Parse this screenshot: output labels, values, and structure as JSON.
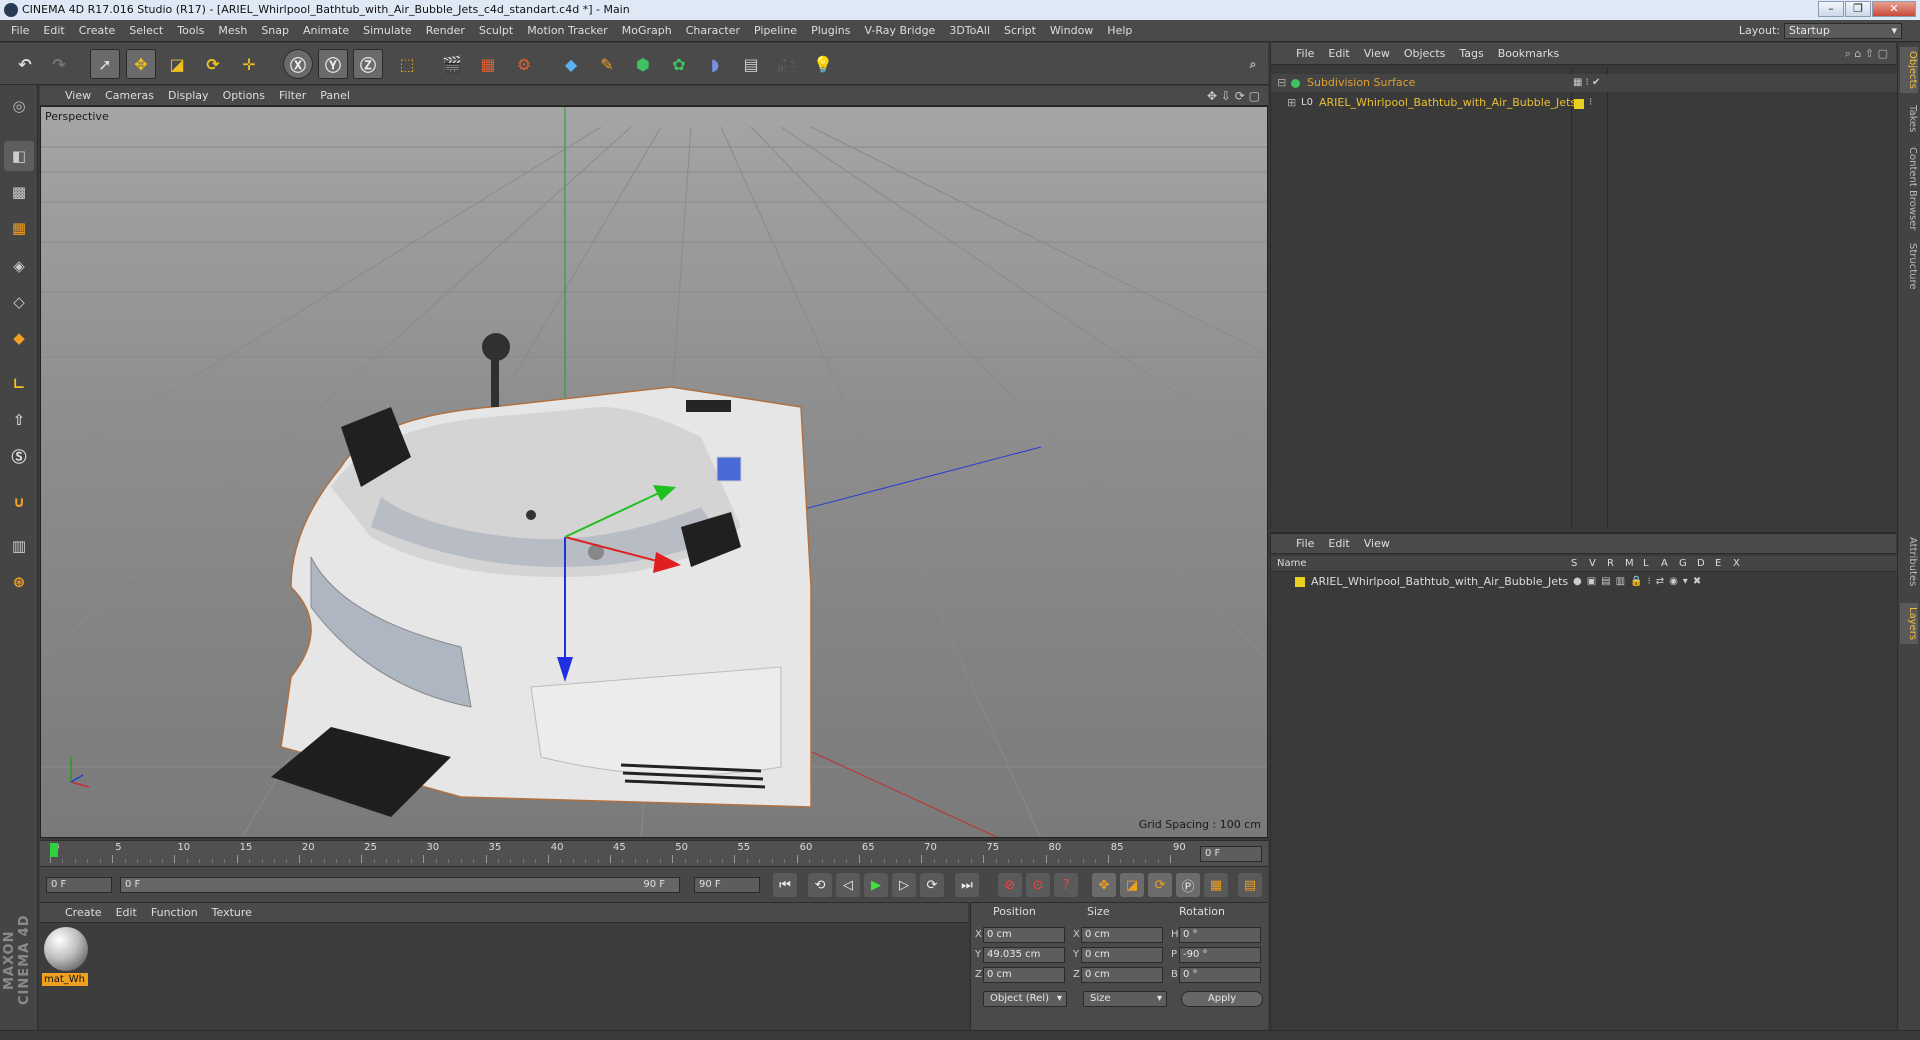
{
  "window": {
    "title": "CINEMA 4D R17.016 Studio (R17) - [ARIEL_Whirlpool_Bathtub_with_Air_Bubble_Jets_c4d_standart.c4d *] - Main"
  },
  "menubar": {
    "items": [
      "File",
      "Edit",
      "Create",
      "Select",
      "Tools",
      "Mesh",
      "Snap",
      "Animate",
      "Simulate",
      "Render",
      "Sculpt",
      "Motion Tracker",
      "MoGraph",
      "Character",
      "Pipeline",
      "Plugins",
      "V-Ray Bridge",
      "3DToAll",
      "Script",
      "Window",
      "Help"
    ],
    "layout_label": "Layout:",
    "layout_value": "Startup"
  },
  "viewport": {
    "menu": [
      "View",
      "Cameras",
      "Display",
      "Options",
      "Filter",
      "Panel"
    ],
    "label": "Perspective",
    "grid_spacing": "Grid Spacing : 100 cm"
  },
  "timeline": {
    "ticks": [
      "0",
      "5",
      "10",
      "15",
      "20",
      "25",
      "30",
      "35",
      "40",
      "45",
      "50",
      "55",
      "60",
      "65",
      "70",
      "75",
      "80",
      "85",
      "90"
    ],
    "end_field": "0 F"
  },
  "anim": {
    "start": "0 F",
    "range_start": "0 F",
    "range_end": "90 F",
    "end": "90 F"
  },
  "material_panel": {
    "menu": [
      "Create",
      "Edit",
      "Function",
      "Texture"
    ],
    "material_name": "mat_Wh"
  },
  "coords": {
    "headers": {
      "position": "Position",
      "size": "Size",
      "rotation": "Rotation"
    },
    "rows": [
      {
        "axis": "X",
        "pos": "0 cm",
        "size_axis": "X",
        "size": "0 cm",
        "rot_axis": "H",
        "rot": "0 °"
      },
      {
        "axis": "Y",
        "pos": "49.035 cm",
        "size_axis": "Y",
        "size": "0 cm",
        "rot_axis": "P",
        "rot": "-90 °"
      },
      {
        "axis": "Z",
        "pos": "0 cm",
        "size_axis": "Z",
        "size": "0 cm",
        "rot_axis": "B",
        "rot": "0 °"
      }
    ],
    "mode": "Object (Rel)",
    "size_mode": "Size",
    "apply": "Apply"
  },
  "objects_panel": {
    "menu": [
      "File",
      "Edit",
      "View",
      "Objects",
      "Tags",
      "Bookmarks"
    ],
    "items": [
      {
        "name": "Subdivision Surface",
        "color": "#e0a030"
      },
      {
        "name": "ARIEL_Whirlpool_Bathtub_with_Air_Bubble_Jets",
        "color": "#e8c030"
      }
    ]
  },
  "layers_panel": {
    "menu": [
      "File",
      "Edit",
      "View"
    ],
    "columns": [
      "Name",
      "S",
      "V",
      "R",
      "M",
      "L",
      "A",
      "G",
      "D",
      "E",
      "X"
    ],
    "rows": [
      {
        "name": "ARIEL_Whirlpool_Bathtub_with_Air_Bubble_Jets",
        "color": "#e8d020"
      }
    ]
  },
  "side_tabs": [
    "Objects",
    "Takes",
    "Content Browser",
    "Structure",
    "Attributes",
    "Layers"
  ],
  "maxon_logo": "MAXON CINEMA 4D",
  "colors": {
    "accent": "#f0c040",
    "x_axis": "#d02020",
    "y_axis": "#20a020",
    "z_axis": "#2040d0"
  }
}
